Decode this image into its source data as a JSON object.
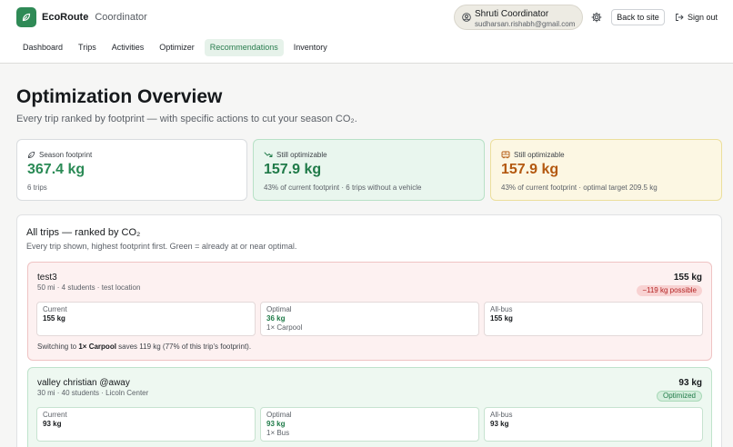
{
  "brand": {
    "name": "EcoRoute",
    "role": "Coordinator",
    "accent": "#2f8a56"
  },
  "user": {
    "name": "Shruti Coordinator",
    "email": "sudharsan.rishabh@gmail.com"
  },
  "header_actions": {
    "back_label": "Back to site",
    "signout_label": "Sign out"
  },
  "nav": {
    "items": [
      "Dashboard",
      "Trips",
      "Activities",
      "Optimizer",
      "Recommendations",
      "Inventory"
    ],
    "active": "Recommendations"
  },
  "page": {
    "title": "Optimization Overview",
    "subtitle": "Every trip ranked by footprint — with specific actions to cut your season CO₂."
  },
  "stats": [
    {
      "label": "Season footprint",
      "value": "367.4 kg",
      "note": "6 trips",
      "icon": "leaf-icon",
      "color": "#2a8a55"
    },
    {
      "label": "Still optimizable",
      "value": "157.9 kg",
      "note": "43% of current footprint · 6 trips without a vehicle",
      "icon": "trend-down-icon",
      "color": "#1f7a48"
    },
    {
      "label": "Still optimizable",
      "value": "157.9 kg",
      "note": "43% of current footprint · optimal target 209.5 kg",
      "icon": "bus-icon",
      "color": "#b3580f"
    }
  ],
  "panel": {
    "title": "All trips — ranked by CO₂",
    "subtitle": "Every trip shown, highest footprint first. Green = already at or near optimal."
  },
  "trips": [
    {
      "name": "test3",
      "meta": "50 mi · 4 students · test location",
      "total": "155 kg",
      "badge": "−119 kg possible",
      "status": "red",
      "current_label": "Current",
      "current_value": "155 kg",
      "optimal_label": "Optimal",
      "optimal_value": "36 kg",
      "optimal_vehicle": "1× Carpool",
      "allbus_label": "All-bus",
      "allbus_value": "155 kg",
      "note_prefix": "Switching to ",
      "note_vehicle": "1× Carpool",
      "note_suffix": " saves 119 kg (77% of this trip's footprint)."
    },
    {
      "name": "valley christian @away",
      "meta": "30 mi · 40 students · Licoln Center",
      "total": "93 kg",
      "badge": "Optimized",
      "status": "green",
      "current_label": "Current",
      "current_value": "93 kg",
      "optimal_label": "Optimal",
      "optimal_value": "93 kg",
      "optimal_vehicle": "1× Bus",
      "allbus_label": "All-bus",
      "allbus_value": "93 kg"
    }
  ]
}
